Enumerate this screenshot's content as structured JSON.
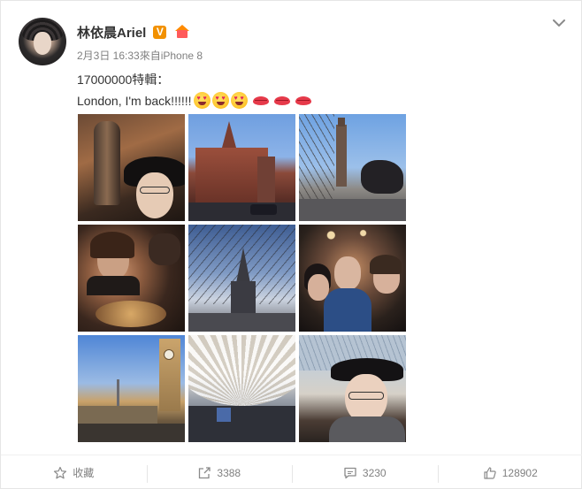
{
  "post": {
    "author": {
      "name": "林依晨Ariel",
      "vip_badge": "V",
      "avatar_icon": "avatar-photo",
      "badge_icon": "house-badge-icon"
    },
    "meta": "2月3日 16:33來自iPhone 8",
    "text": {
      "line1": "17000000特輯：",
      "line2": "London, I'm back!!!!!!"
    },
    "emojis": [
      "heart-eyes-emoji",
      "heart-eyes-emoji",
      "heart-eyes-emoji",
      "lips-emoji",
      "lips-emoji",
      "lips-emoji"
    ],
    "photos": [
      {
        "id": "photo-1",
        "subject": "statue-selfie"
      },
      {
        "id": "photo-2",
        "subject": "st-pancras-building"
      },
      {
        "id": "photo-3",
        "subject": "tower-and-sculpture"
      },
      {
        "id": "photo-4",
        "subject": "restaurant-dinner"
      },
      {
        "id": "photo-5",
        "subject": "church-spire"
      },
      {
        "id": "photo-6",
        "subject": "group-selfie"
      },
      {
        "id": "photo-7",
        "subject": "kings-cross-clock-tower"
      },
      {
        "id": "photo-8",
        "subject": "kings-cross-roof"
      },
      {
        "id": "photo-9",
        "subject": "station-selfie"
      }
    ]
  },
  "actions": {
    "favorite": {
      "label": "收藏",
      "icon": "star-icon"
    },
    "share": {
      "label": "3388",
      "icon": "share-icon"
    },
    "comment": {
      "label": "3230",
      "icon": "comment-icon"
    },
    "like": {
      "label": "128902",
      "icon": "thumbs-up-icon"
    }
  },
  "colors": {
    "vip": "#f29100",
    "text": "#333333",
    "meta": "#808080"
  }
}
